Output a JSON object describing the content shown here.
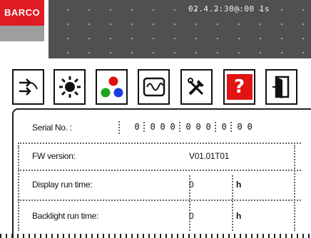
{
  "header": {
    "logo_text": "BARCO",
    "datetime": "02.4.2:30@:00 1s",
    "accent_color": "#e01b22"
  },
  "toolbar": {
    "tabs": [
      {
        "icon": "connection-arrows-icon"
      },
      {
        "icon": "brightness-sun-icon"
      },
      {
        "icon": "color-rgb-icon"
      },
      {
        "icon": "signal-wave-icon"
      },
      {
        "icon": "tools-icon"
      },
      {
        "icon": "help-icon",
        "label": "?"
      },
      {
        "icon": "exit-door-icon"
      }
    ]
  },
  "info": {
    "serial_label": "Serial No. :",
    "serial_digits": [
      "0",
      "0",
      "0",
      "0",
      "0",
      "0",
      "0",
      "0",
      "0",
      "0"
    ],
    "fw_label": "FW version:",
    "fw_value": "V01.01T01",
    "display_label": "Display run time:",
    "display_value": "0",
    "display_unit": "h",
    "backlight_label": "Backlight run time:",
    "backlight_value": "0",
    "backlight_unit": "h"
  }
}
